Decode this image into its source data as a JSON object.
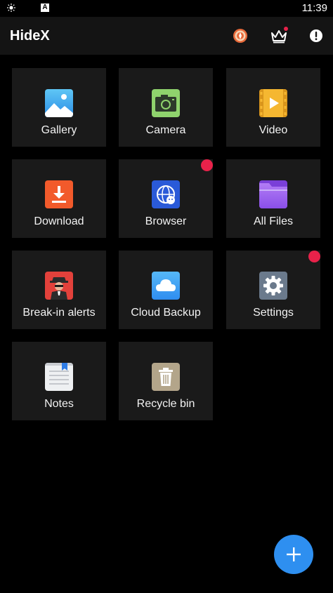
{
  "status_bar": {
    "time": "11:39",
    "icons": [
      "brightness-icon",
      "a-icon"
    ]
  },
  "app_bar": {
    "title": "HideX",
    "actions": [
      "theme-icon",
      "crown-icon",
      "info-icon"
    ],
    "crown_has_notification": true
  },
  "tiles": [
    {
      "label": "Gallery",
      "icon": "gallery-icon",
      "badge": false
    },
    {
      "label": "Camera",
      "icon": "camera-icon",
      "badge": false
    },
    {
      "label": "Video",
      "icon": "video-icon",
      "badge": false
    },
    {
      "label": "Download",
      "icon": "download-icon",
      "badge": false
    },
    {
      "label": "Browser",
      "icon": "browser-icon",
      "badge": true
    },
    {
      "label": "All Files",
      "icon": "folder-icon",
      "badge": false
    },
    {
      "label": "Break-in alerts",
      "icon": "intruder-icon",
      "badge": false
    },
    {
      "label": "Cloud Backup",
      "icon": "cloud-icon",
      "badge": false
    },
    {
      "label": "Settings",
      "icon": "gear-icon",
      "badge": true
    },
    {
      "label": "Notes",
      "icon": "notes-icon",
      "badge": false
    },
    {
      "label": "Recycle bin",
      "icon": "trash-icon",
      "badge": false
    }
  ],
  "fab": {
    "icon": "plus-icon"
  },
  "colors": {
    "background": "#000000",
    "tile": "#1a1a1a",
    "badge": "#e8224a",
    "fab": "#2e8ff0"
  }
}
